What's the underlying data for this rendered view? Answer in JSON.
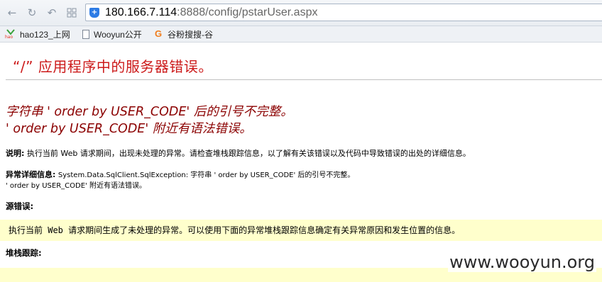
{
  "browser": {
    "url_host": "180.166.7.114",
    "url_rest": ":8888/config/pstarUser.aspx",
    "bookmarks": [
      {
        "label": "hao123_上网",
        "icon": "hao123-icon"
      },
      {
        "label": "Wooyun公开",
        "icon": "page-icon"
      },
      {
        "label": "谷粉搜搜-谷",
        "icon": "g-icon"
      }
    ]
  },
  "page": {
    "title": "“/” 应用程序中的服务器错误。",
    "error_line1": "字符串 ' order by USER_CODE' 后的引号不完整。",
    "error_line2": "' order by USER_CODE' 附近有语法错误。",
    "description_label": "说明:",
    "description_text": "执行当前 Web 请求期间，出现未处理的异常。请检查堆栈跟踪信息，以了解有关该错误以及代码中导致错误的出处的详细信息。",
    "exception_label": "异常详细信息:",
    "exception_text": "System.Data.SqlClient.SqlException: 字符串 ' order by USER_CODE' 后的引号不完整。",
    "exception_text2": "' order by USER_CODE' 附近有语法错误。",
    "source_label": "源错误:",
    "source_text": "执行当前 Web 请求期间生成了未处理的异常。可以使用下面的异常堆栈跟踪信息确定有关异常原因和发生位置的信息。",
    "stack_label": "堆栈跟踪:"
  },
  "watermark": "www.wooyun.org",
  "colors": {
    "title": "#cc1a1a",
    "error": "#8b0000",
    "code_bg": "#ffffcc"
  }
}
